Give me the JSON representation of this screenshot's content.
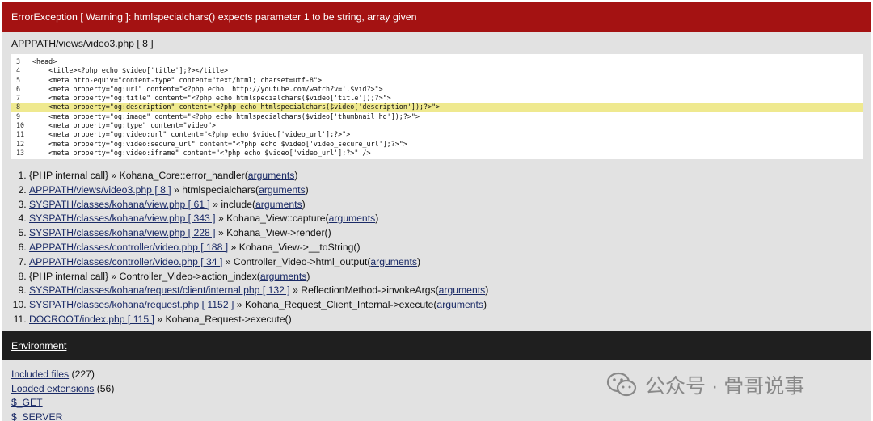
{
  "error": {
    "header": "ErrorException [ Warning ]: htmlspecialchars() expects parameter 1 to be string, array given",
    "file": "APPPATH/views/video3.php [ 8 ]"
  },
  "code": [
    {
      "n": "3",
      "text": "<head>",
      "hl": false
    },
    {
      "n": "4",
      "text": "    <title><?php echo $video['title'];?></title>",
      "hl": false
    },
    {
      "n": "5",
      "text": "    <meta http-equiv=\"content-type\" content=\"text/html; charset=utf-8\">",
      "hl": false
    },
    {
      "n": "6",
      "text": "    <meta property=\"og:url\" content=\"<?php echo 'http://youtube.com/watch?v='.$vid?>\">",
      "hl": false
    },
    {
      "n": "7",
      "text": "    <meta property=\"og:title\" content=\"<?php echo htmlspecialchars($video['title']);?>\">",
      "hl": false
    },
    {
      "n": "8",
      "text": "    <meta property=\"og:description\" content=\"<?php echo htmlspecialchars($video['description']);?>\">",
      "hl": true
    },
    {
      "n": "9",
      "text": "    <meta property=\"og:image\" content=\"<?php echo htmlspecialchars($video['thumbnail_hq']);?>\">",
      "hl": false
    },
    {
      "n": "10",
      "text": "    <meta property=\"og:type\" content=\"video\">",
      "hl": false
    },
    {
      "n": "11",
      "text": "    <meta property=\"og:video:url\" content=\"<?php echo $video['video_url'];?>\">",
      "hl": false
    },
    {
      "n": "12",
      "text": "    <meta property=\"og:video:secure_url\" content=\"<?php echo $video['video_secure_url'];?>\">",
      "hl": false
    },
    {
      "n": "13",
      "text": "    <meta property=\"og:video:iframe\" content=\"<?php echo $video['video_url'];?>\" />",
      "hl": false
    }
  ],
  "trace": [
    {
      "file": "",
      "plain": "{PHP internal call}",
      "sep": " » ",
      "func": "Kohana_Core::error_handler(",
      "args": "arguments",
      "close": ")"
    },
    {
      "file": "APPPATH/views/video3.php [ 8 ]",
      "plain": "",
      "sep": " » ",
      "func": "htmlspecialchars(",
      "args": "arguments",
      "close": ")"
    },
    {
      "file": "SYSPATH/classes/kohana/view.php [ 61 ]",
      "plain": "",
      "sep": " » ",
      "func": "include(",
      "args": "arguments",
      "close": ")"
    },
    {
      "file": "SYSPATH/classes/kohana/view.php [ 343 ]",
      "plain": "",
      "sep": " » ",
      "func": "Kohana_View::capture(",
      "args": "arguments",
      "close": ")"
    },
    {
      "file": "SYSPATH/classes/kohana/view.php [ 228 ]",
      "plain": "",
      "sep": " » ",
      "func": "Kohana_View->render()",
      "args": "",
      "close": ""
    },
    {
      "file": "APPPATH/classes/controller/video.php [ 188 ]",
      "plain": "",
      "sep": " » ",
      "func": "Kohana_View->__toString()",
      "args": "",
      "close": ""
    },
    {
      "file": "APPPATH/classes/controller/video.php [ 34 ]",
      "plain": "",
      "sep": " » ",
      "func": "Controller_Video->html_output(",
      "args": "arguments",
      "close": ")"
    },
    {
      "file": "",
      "plain": "{PHP internal call}",
      "sep": " » ",
      "func": "Controller_Video->action_index(",
      "args": "arguments",
      "close": ")"
    },
    {
      "file": "SYSPATH/classes/kohana/request/client/internal.php [ 132 ]",
      "plain": "",
      "sep": " » ",
      "func": "ReflectionMethod->invokeArgs(",
      "args": "arguments",
      "close": ")"
    },
    {
      "file": "SYSPATH/classes/kohana/request.php [ 1152 ]",
      "plain": "",
      "sep": " » ",
      "func": "Kohana_Request_Client_Internal->execute(",
      "args": "arguments",
      "close": ")"
    },
    {
      "file": "DOCROOT/index.php [ 115 ]",
      "plain": "",
      "sep": " » ",
      "func": "Kohana_Request->execute()",
      "args": "",
      "close": ""
    }
  ],
  "environment": {
    "title": "Environment",
    "items": [
      {
        "label": "Included files",
        "count": " (227)"
      },
      {
        "label": "Loaded extensions",
        "count": " (56)"
      },
      {
        "label": "$_GET",
        "count": ""
      },
      {
        "label": "$_SERVER",
        "count": ""
      }
    ]
  },
  "watermark": {
    "text": "公众号 · 骨哥说事",
    "icon": "wechat-icon"
  }
}
